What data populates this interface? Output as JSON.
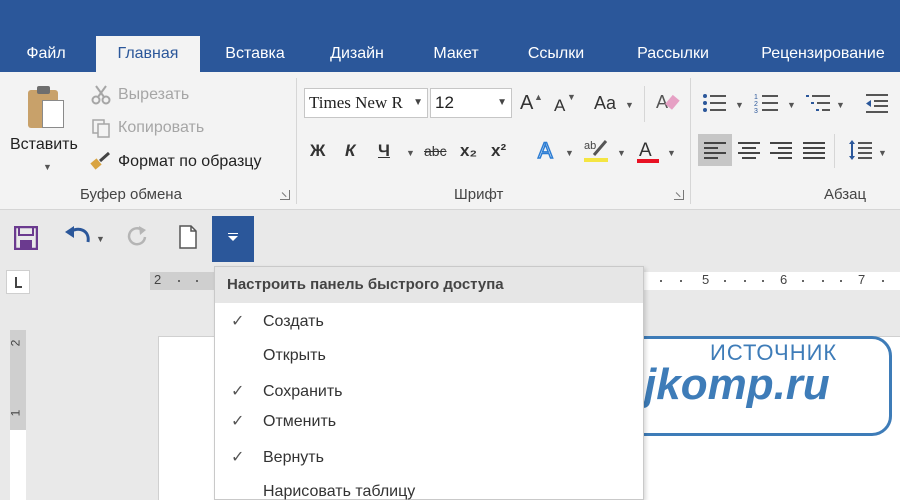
{
  "tabs": [
    "Файл",
    "Главная",
    "Вставка",
    "Дизайн",
    "Макет",
    "Ссылки",
    "Рассылки",
    "Рецензирование"
  ],
  "active_tab": "Главная",
  "clipboard": {
    "paste": "Вставить",
    "cut": "Вырезать",
    "copy": "Копировать",
    "format_painter": "Формат по образцу",
    "group_label": "Буфер обмена"
  },
  "font": {
    "font_name": "Times New R",
    "font_size": "12",
    "bold": "Ж",
    "italic": "К",
    "underline": "Ч",
    "strike": "abc",
    "subscript": "x₂",
    "superscript": "x²",
    "case": "Aa",
    "grow": "A",
    "shrink": "A",
    "group_label": "Шрифт"
  },
  "paragraph": {
    "group_label": "Абзац"
  },
  "menu": {
    "title": "Настроить панель быстрого доступа",
    "items": [
      {
        "label": "Создать",
        "checked": true
      },
      {
        "label": "Открыть",
        "checked": false
      },
      {
        "label": "Сохранить",
        "checked": true
      },
      {
        "label": "Отменить",
        "checked": true
      },
      {
        "label": "Вернуть",
        "checked": true
      },
      {
        "label": "Нарисовать таблицу",
        "checked": false
      }
    ],
    "check_glyph": "✓"
  },
  "ruler": {
    "numbers": [
      "2",
      "5",
      "6",
      "7"
    ]
  },
  "vruler": {
    "numbers": [
      "2",
      "1"
    ]
  },
  "watermark": {
    "top": "ИСТОЧНИК",
    "main": "tvojkomp.ru"
  },
  "colors": {
    "accent": "#2b579a",
    "font_color_bar": "#e81123",
    "watermark": "#3e7cb8"
  }
}
